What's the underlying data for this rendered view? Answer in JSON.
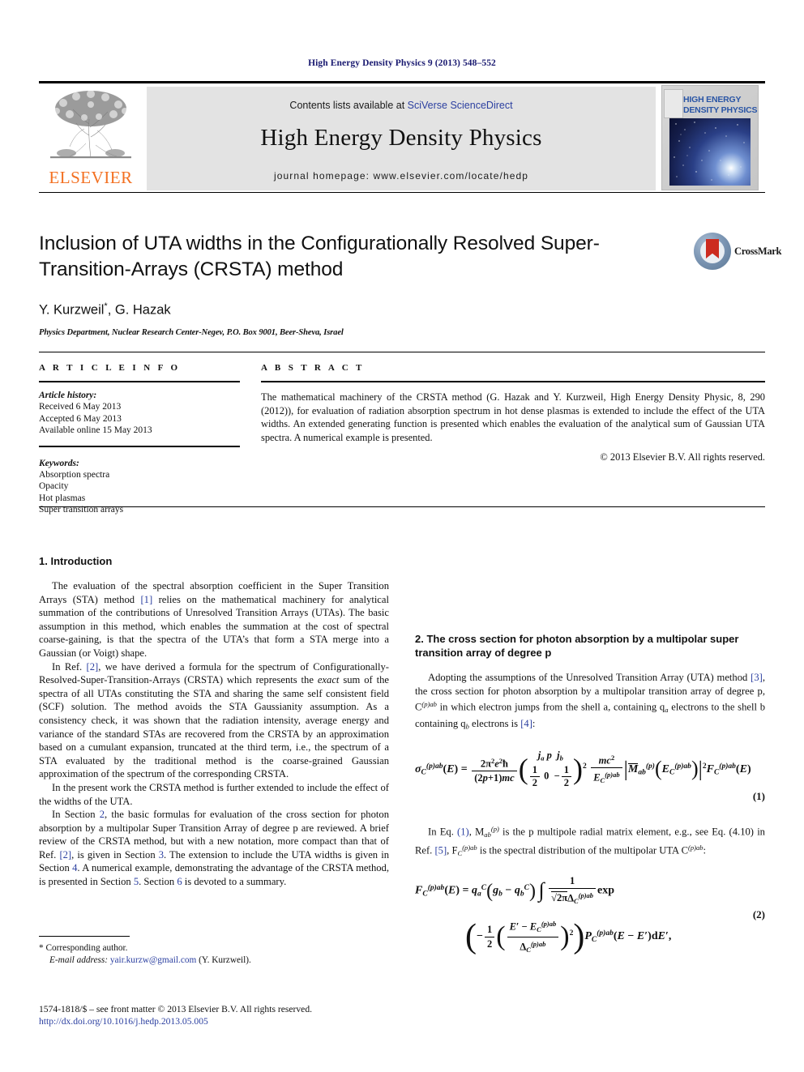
{
  "running_head": "High Energy Density Physics 9 (2013) 548–552",
  "banner": {
    "publisher_name": "ELSEVIER",
    "contents_prefix": "Contents lists available at ",
    "contents_link": "SciVerse ScienceDirect",
    "journal_title": "High Energy Density Physics",
    "homepage_line": "journal homepage: www.elsevier.com/locate/hedp",
    "cover_title_line1": "HIGH ENERGY",
    "cover_title_line2": "DENSITY PHYSICS",
    "link_color": "#2b3fa0",
    "elsevier_orange": "#F37021"
  },
  "article": {
    "title": "Inclusion of UTA widths in the Configurationally Resolved Super-Transition-Arrays (CRSTA) method",
    "authors": "Y. Kurzweil",
    "author_star": "*",
    "authors_rest": ", G. Hazak",
    "affiliation": "Physics Department, Nuclear Research Center-Negev, P.O. Box 9001, Beer-Sheva, Israel",
    "crossmark_label": "CrossMark"
  },
  "article_info": {
    "section_label": "A R T I C L E  I N F O",
    "history_heading": "Article history:",
    "history": [
      "Received 6 May 2013",
      "Accepted 6 May 2013",
      "Available online 15 May 2013"
    ],
    "keywords_heading": "Keywords:",
    "keywords": [
      "Absorption spectra",
      "Opacity",
      "Hot plasmas",
      "Super transition arrays"
    ]
  },
  "abstract": {
    "section_label": "A B S T R A C T",
    "text": "The mathematical machinery of the CRSTA method (G. Hazak and Y. Kurzweil, High Energy Density Physic, 8, 290 (2012)), for evaluation of radiation absorption spectrum in hot dense plasmas is extended to include the effect of the UTA widths. An extended generating function is presented which enables the evaluation of the analytical sum of Gaussian UTA spectra. A numerical example is presented.",
    "copyright": "© 2013 Elsevier B.V. All rights reserved."
  },
  "body": {
    "section1_heading": "1.  Introduction",
    "p1_a": "The evaluation of the spectral absorption coefficient in the Super Transition Arrays (STA) method ",
    "p1_ref": "[1]",
    "p1_b": " relies on the mathematical machinery for analytical summation of the contributions of Unresolved Transition Arrays (UTAs). The basic assumption in this method, which enables the summation at the cost of spectral coarse-gaining, is that the spectra of the UTA’s that form a STA merge into a Gaussian (or Voigt) shape.",
    "p2_a": "In Ref. ",
    "p2_ref": "[2]",
    "p2_b": ", we have derived a formula for the spectrum of Configurationally-Resolved-Super-Transition-Arrays (CRSTA) which represents the ",
    "p2_italic": "exact",
    "p2_c": " sum of the spectra of all UTAs constituting the STA and sharing the same self consistent field (SCF) solution. The method avoids the STA Gaussianity assumption. As a consistency check, it was shown that the radiation intensity, average energy and variance of the standard STAs are recovered from the CRSTA by an approximation based on a cumulant expansion, truncated at the third term, i.e., the spectrum of a STA evaluated by the traditional method is the coarse-grained Gaussian approximation of the spectrum of the corresponding CRSTA.",
    "p3": "In the present work the CRSTA method is further extended to include the effect of the widths of the UTA.",
    "p4_a": "In Section ",
    "p4_ref": "2",
    "p4_b": ", the basic formulas for evaluation of the cross section for photon absorption by a multipolar Super Transition Array of degree p are reviewed. A brief review of the CRSTA method, but with a new notation, more compact than that of Ref. ",
    "p4_ref2": "[2]",
    "p4_c": ", is given in Section ",
    "p4_ref3": "3",
    "p4_d": ". The extension to include the UTA widths is given in Section ",
    "p4_ref4": "4",
    "p4_e": ". A numerical example, demonstrating the advantage of the CRSTA method, is presented in Section ",
    "p4_ref5": "5",
    "p4_f": ". Section ",
    "p4_ref6": "6",
    "p4_g": " is devoted to a summary.",
    "section2_heading": "2.  The cross section for photon absorption by a multipolar super transition array of degree p",
    "p5_a": "Adopting the assumptions of the Unresolved Transition Array (UTA) method ",
    "p5_ref": "[3]",
    "p5_b": ", the cross section for photon absorption by a multipolar transition array of degree p, C",
    "p5_sup": "(p)ab",
    "p5_c": " in which electron jumps from the shell a, containing q",
    "p5_sub": "a",
    "p5_d": " electrons to the shell b containing q",
    "p5_sub2": "b",
    "p5_e": " electrons is ",
    "p5_ref2": "[4]",
    "p5_f": ":",
    "p6_a": "In Eq. ",
    "p6_ref": "(1)",
    "p6_b": ", M",
    "p6_c": " is the p multipole radial matrix element, e.g., see Eq. (4.10) in Ref. ",
    "p6_ref2": "[5]",
    "p6_d": ", F",
    "p6_e": " is the spectral distribution of the multipolar UTA C",
    "p6_f": ":",
    "eq1_number": "(1)",
    "eq2_number": "(2)"
  },
  "footnote": {
    "corresponding": "* Corresponding author.",
    "email_label": "E-mail address:",
    "email": "yair.kurzw@gmail.com",
    "email_attrib": "(Y. Kurzweil).",
    "issn_line": "1574-1818/$ – see front matter © 2013 Elsevier B.V. All rights reserved.",
    "doi": "http://dx.doi.org/10.1016/j.hedp.2013.05.005"
  }
}
